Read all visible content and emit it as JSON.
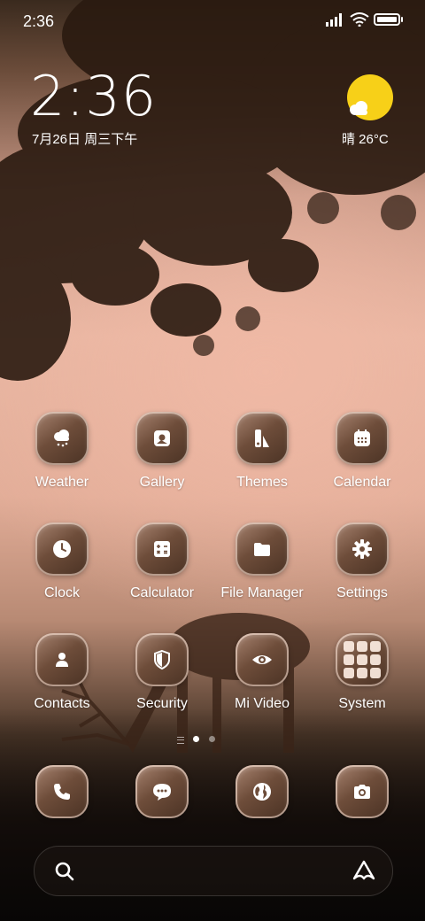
{
  "status_bar": {
    "time": "2:36"
  },
  "lockscreen_widget": {
    "clock": "2:36",
    "date": "7月26日 周三下午",
    "weather": "晴 26°C",
    "weather_icon": "sun-cloud-icon"
  },
  "apps": [
    {
      "label": "Weather",
      "icon": "weather-cloud-icon"
    },
    {
      "label": "Gallery",
      "icon": "gallery-icon"
    },
    {
      "label": "Themes",
      "icon": "themes-icon"
    },
    {
      "label": "Calendar",
      "icon": "calendar-icon"
    },
    {
      "label": "Clock",
      "icon": "clock-icon"
    },
    {
      "label": "Calculator",
      "icon": "calculator-icon"
    },
    {
      "label": "File Manager",
      "icon": "folder-icon"
    },
    {
      "label": "Settings",
      "icon": "gear-icon"
    },
    {
      "label": "Contacts",
      "icon": "person-icon"
    },
    {
      "label": "Security",
      "icon": "shield-icon"
    },
    {
      "label": "Mi Video",
      "icon": "eye-icon"
    },
    {
      "label": "System",
      "icon": "app-folder-icon"
    }
  ],
  "page_indicator": {
    "pages": 2,
    "active": 1
  },
  "dock": [
    {
      "icon": "phone-icon"
    },
    {
      "icon": "messages-icon"
    },
    {
      "icon": "browser-globe-icon"
    },
    {
      "icon": "camera-icon"
    }
  ],
  "search_bar": {
    "left_icon": "search-icon",
    "right_icon": "assistant-icon"
  },
  "colors": {
    "sun": "#f7d018",
    "icon_bg": "#6e4d3a"
  }
}
